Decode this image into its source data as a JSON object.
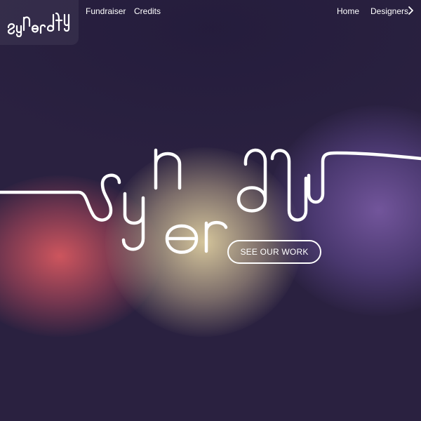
{
  "brand": {
    "logo_icon": "synergy-wordmark-logo",
    "wordmark": "synergy"
  },
  "nav": {
    "left": [
      {
        "label": "Fundraiser"
      },
      {
        "label": "Credits"
      }
    ],
    "right": [
      {
        "label": "Home"
      },
      {
        "label": "Designers"
      }
    ],
    "chevron_icon": "chevron-right-icon"
  },
  "hero": {
    "cta_label": "SEE OUR WORK"
  },
  "colors": {
    "background": "#2a2140",
    "blob_red": "#d6585f",
    "blob_cream": "#decea0",
    "blob_purple": "#7658a0",
    "foreground": "#ffffff"
  }
}
